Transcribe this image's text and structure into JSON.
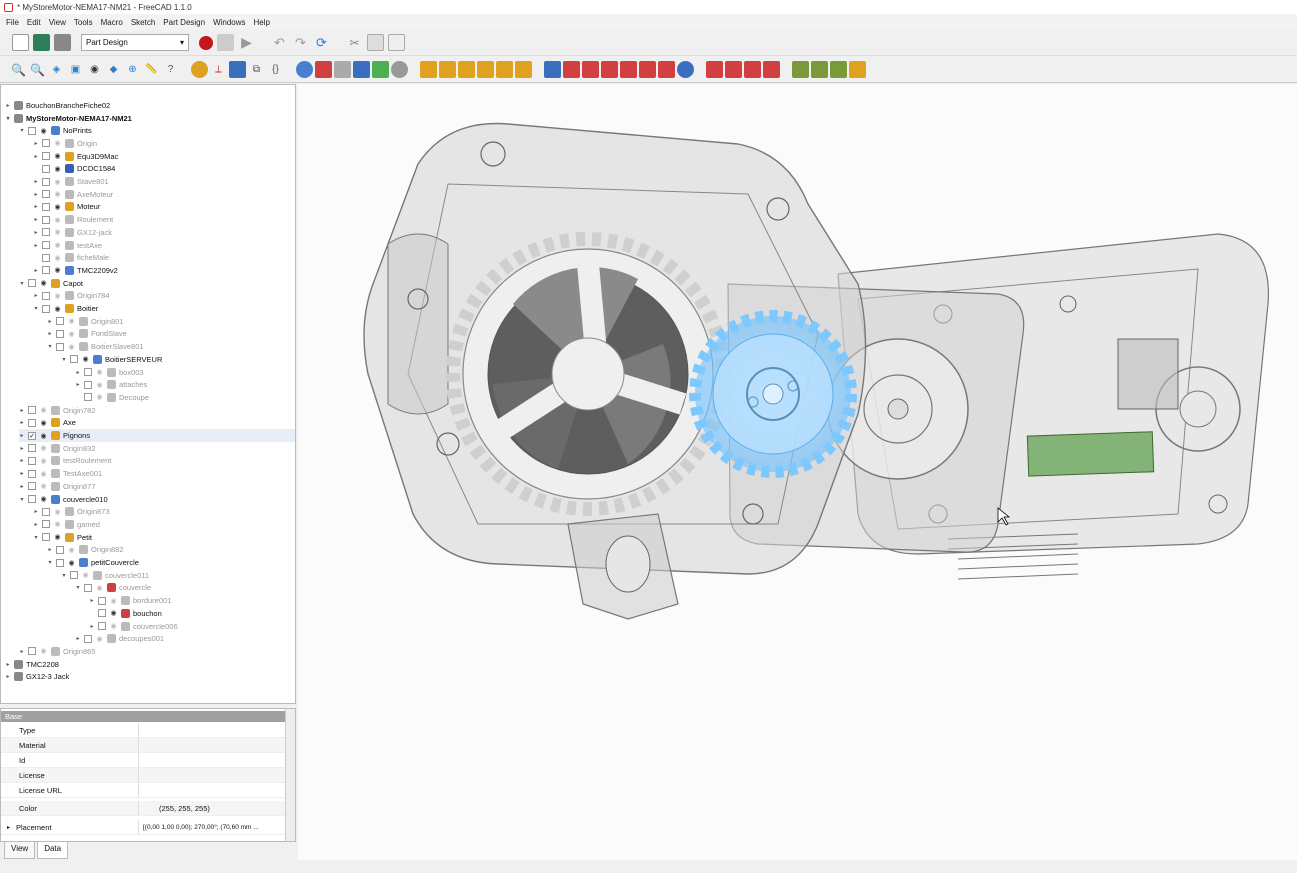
{
  "window": {
    "title": "* MyStoreMotor-NEMA17-NM21 - FreeCAD 1.1.0"
  },
  "menu": [
    "File",
    "Edit",
    "View",
    "Tools",
    "Macro",
    "Sketch",
    "Part Design",
    "Windows",
    "Help"
  ],
  "workbench": {
    "selected": "Part Design"
  },
  "tree": [
    {
      "label": "BouchonBrancheFiche02",
      "indent": 0,
      "arrow": "▸",
      "cb": "",
      "eye": "",
      "icon": "#888",
      "style": ""
    },
    {
      "label": "MyStoreMotor-NEMA17-NM21",
      "indent": 0,
      "arrow": "▾",
      "cb": "",
      "eye": "",
      "icon": "#888",
      "style": "bold"
    },
    {
      "label": "NoPrints",
      "indent": 1,
      "arrow": "▾",
      "cb": "",
      "eye": "👁",
      "icon": "#4a7fd0",
      "style": ""
    },
    {
      "label": "Origin",
      "indent": 2,
      "arrow": "▸",
      "cb": "",
      "eye": "👁",
      "icon": "#bbb",
      "style": "dim"
    },
    {
      "label": "Equ3D9Mac",
      "indent": 2,
      "arrow": "▸",
      "cb": "",
      "eye": "👁",
      "icon": "#e0a020",
      "style": ""
    },
    {
      "label": "DCDC1584",
      "indent": 2,
      "arrow": "",
      "cb": "",
      "eye": "👁",
      "icon": "#3a5fb0",
      "style": ""
    },
    {
      "label": "Stave801",
      "indent": 2,
      "arrow": "▸",
      "cb": "",
      "eye": "👁",
      "icon": "#bbb",
      "style": "dim"
    },
    {
      "label": "AxeMoteur",
      "indent": 2,
      "arrow": "▸",
      "cb": "",
      "eye": "👁",
      "icon": "#bbb",
      "style": "dim"
    },
    {
      "label": "Moteur",
      "indent": 2,
      "arrow": "▸",
      "cb": "",
      "eye": "👁",
      "icon": "#e0a020",
      "style": ""
    },
    {
      "label": "Roulement",
      "indent": 2,
      "arrow": "▸",
      "cb": "",
      "eye": "👁",
      "icon": "#bbb",
      "style": "dim"
    },
    {
      "label": "GX12-jack",
      "indent": 2,
      "arrow": "▸",
      "cb": "",
      "eye": "👁",
      "icon": "#bbb",
      "style": "dim"
    },
    {
      "label": "testAxe",
      "indent": 2,
      "arrow": "▸",
      "cb": "",
      "eye": "👁",
      "icon": "#bbb",
      "style": "dim"
    },
    {
      "label": "ficheMale",
      "indent": 2,
      "arrow": "",
      "cb": "",
      "eye": "👁",
      "icon": "#bbb",
      "style": "dim"
    },
    {
      "label": "TMC2209v2",
      "indent": 2,
      "arrow": "▸",
      "cb": "",
      "eye": "👁",
      "icon": "#4a7fd0",
      "style": ""
    },
    {
      "label": "Capot",
      "indent": 1,
      "arrow": "▾",
      "cb": "",
      "eye": "👁",
      "icon": "#e0a020",
      "style": ""
    },
    {
      "label": "Origin784",
      "indent": 2,
      "arrow": "▸",
      "cb": "",
      "eye": "👁",
      "icon": "#bbb",
      "style": "dim"
    },
    {
      "label": "Boitier",
      "indent": 2,
      "arrow": "▾",
      "cb": "",
      "eye": "👁",
      "icon": "#e0a020",
      "style": ""
    },
    {
      "label": "Origin801",
      "indent": 3,
      "arrow": "▸",
      "cb": "",
      "eye": "👁",
      "icon": "#bbb",
      "style": "dim"
    },
    {
      "label": "FondSlave",
      "indent": 3,
      "arrow": "▸",
      "cb": "",
      "eye": "👁",
      "icon": "#bbb",
      "style": "dim"
    },
    {
      "label": "BoitierSlave801",
      "indent": 3,
      "arrow": "▾",
      "cb": "",
      "eye": "👁",
      "icon": "#bbb",
      "style": "dim"
    },
    {
      "label": "BoitierSERVEUR",
      "indent": 4,
      "arrow": "▾",
      "cb": "",
      "eye": "👁",
      "icon": "#4a7fd0",
      "style": ""
    },
    {
      "label": "box003",
      "indent": 5,
      "arrow": "▸",
      "cb": "",
      "eye": "👁",
      "icon": "#bbb",
      "style": "dim"
    },
    {
      "label": "attaches",
      "indent": 5,
      "arrow": "▸",
      "cb": "",
      "eye": "👁",
      "icon": "#bbb",
      "style": "dim"
    },
    {
      "label": "Decoupe",
      "indent": 5,
      "arrow": "",
      "cb": "",
      "eye": "👁",
      "icon": "#bbb",
      "style": "dim"
    },
    {
      "label": "Origin782",
      "indent": 1,
      "arrow": "▸",
      "cb": "",
      "eye": "👁",
      "icon": "#bbb",
      "style": "dim"
    },
    {
      "label": "Axe",
      "indent": 1,
      "arrow": "▸",
      "cb": "",
      "eye": "👁",
      "icon": "#e0a020",
      "style": ""
    },
    {
      "label": "Pignons",
      "indent": 1,
      "arrow": "▸",
      "cb": "✓",
      "eye": "👁",
      "icon": "#e0a020",
      "style": ""
    },
    {
      "label": "Origin832",
      "indent": 1,
      "arrow": "▸",
      "cb": "",
      "eye": "👁",
      "icon": "#bbb",
      "style": "dim"
    },
    {
      "label": "testRoulement",
      "indent": 1,
      "arrow": "▸",
      "cb": "",
      "eye": "👁",
      "icon": "#bbb",
      "style": "dim"
    },
    {
      "label": "TestAxe001",
      "indent": 1,
      "arrow": "▸",
      "cb": "",
      "eye": "👁",
      "icon": "#bbb",
      "style": "dim"
    },
    {
      "label": "Origin877",
      "indent": 1,
      "arrow": "▸",
      "cb": "",
      "eye": "👁",
      "icon": "#bbb",
      "style": "dim"
    },
    {
      "label": "couvercle010",
      "indent": 1,
      "arrow": "▾",
      "cb": "",
      "eye": "👁",
      "icon": "#4a7fd0",
      "style": ""
    },
    {
      "label": "Origin873",
      "indent": 2,
      "arrow": "▸",
      "cb": "",
      "eye": "👁",
      "icon": "#bbb",
      "style": "dim"
    },
    {
      "label": "gamed",
      "indent": 2,
      "arrow": "▸",
      "cb": "",
      "eye": "👁",
      "icon": "#bbb",
      "style": "dim"
    },
    {
      "label": "Petit",
      "indent": 2,
      "arrow": "▾",
      "cb": "",
      "eye": "👁",
      "icon": "#e0a020",
      "style": ""
    },
    {
      "label": "Origin882",
      "indent": 3,
      "arrow": "▸",
      "cb": "",
      "eye": "👁",
      "icon": "#bbb",
      "style": "dim"
    },
    {
      "label": "petitCouvercle",
      "indent": 3,
      "arrow": "▾",
      "cb": "",
      "eye": "👁",
      "icon": "#4a7fd0",
      "style": ""
    },
    {
      "label": "couvercle011",
      "indent": 4,
      "arrow": "▾",
      "cb": "",
      "eye": "👁",
      "icon": "#bbb",
      "style": "dim"
    },
    {
      "label": "couvercle",
      "indent": 5,
      "arrow": "▾",
      "cb": "",
      "eye": "👁",
      "icon": "#d04040",
      "style": "dim"
    },
    {
      "label": "bordure001",
      "indent": 6,
      "arrow": "▸",
      "cb": "",
      "eye": "👁",
      "icon": "#bbb",
      "style": "dim"
    },
    {
      "label": "bouchon",
      "indent": 6,
      "arrow": "",
      "cb": "",
      "eye": "👁",
      "icon": "#d04040",
      "style": ""
    },
    {
      "label": "couvercle006",
      "indent": 6,
      "arrow": "▸",
      "cb": "",
      "eye": "👁",
      "icon": "#bbb",
      "style": "dim"
    },
    {
      "label": "decoupes001",
      "indent": 5,
      "arrow": "▸",
      "cb": "",
      "eye": "👁",
      "icon": "#bbb",
      "style": "dim"
    },
    {
      "label": "Origin865",
      "indent": 1,
      "arrow": "▸",
      "cb": "",
      "eye": "👁",
      "icon": "#bbb",
      "style": "dim"
    },
    {
      "label": "TMC2208",
      "indent": 0,
      "arrow": "▸",
      "cb": "",
      "eye": "",
      "icon": "#888",
      "style": ""
    },
    {
      "label": "GX12-3 Jack",
      "indent": 0,
      "arrow": "▸",
      "cb": "",
      "eye": "",
      "icon": "#888",
      "style": ""
    }
  ],
  "properties": {
    "group": "Base",
    "rows": [
      {
        "key": "Type",
        "value": ""
      },
      {
        "key": "Material",
        "value": ""
      },
      {
        "key": "Id",
        "value": ""
      },
      {
        "key": "License",
        "value": ""
      },
      {
        "key": "License URL",
        "value": ""
      },
      {
        "key": "Color",
        "value": "(255, 255, 255)"
      },
      {
        "key": "Placement",
        "value": "[(0,00 1,00 0,00); 270,00°; (70,60 mm ..."
      }
    ]
  },
  "tabs": [
    "View",
    "Data"
  ],
  "colors": {
    "accent": "#3a7bd5",
    "record": "#c4161c",
    "gear_highlight": "#6cc0ff"
  }
}
